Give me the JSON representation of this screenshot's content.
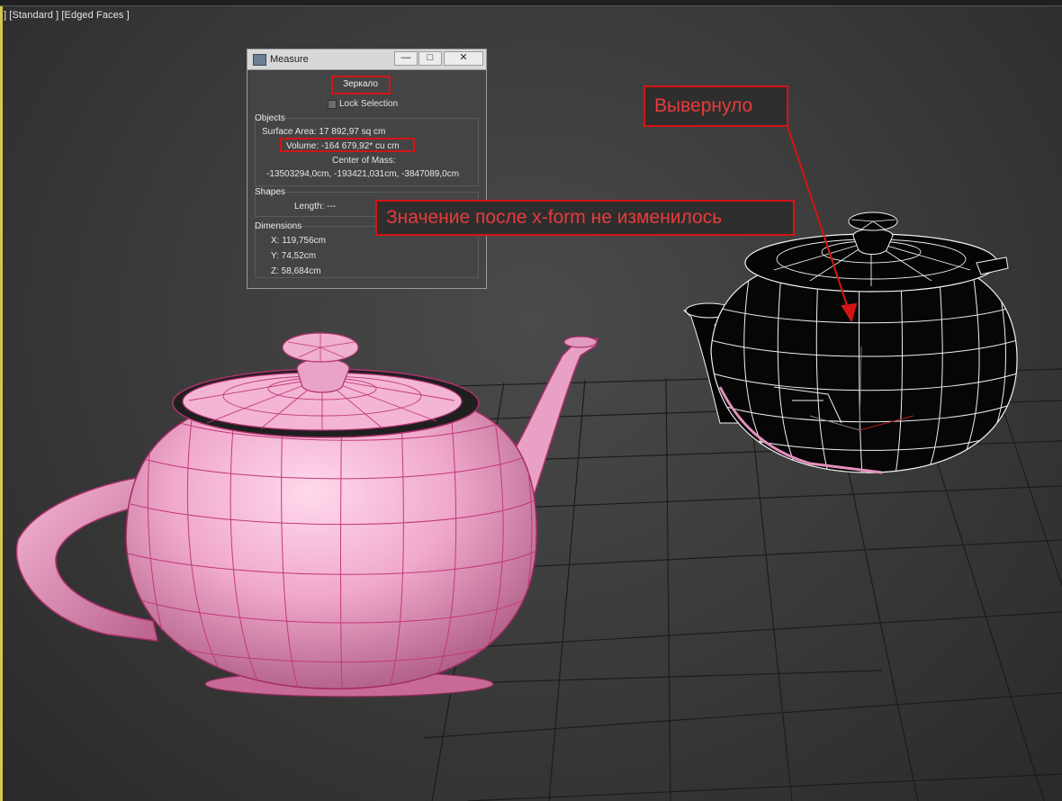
{
  "viewport": {
    "label": "] [Standard ] [Edged Faces ]"
  },
  "measure_dialog": {
    "title": "Measure",
    "controls": {
      "minimize": "—",
      "maximize": "□",
      "close": "✕"
    },
    "mirror_button": "Зеркало",
    "lock_selection": "Lock Selection",
    "objects": {
      "title": "Objects",
      "surface_area": "Surface Area:  17 892,97 sq cm",
      "volume": "Volume:  -164 679,92* cu cm",
      "center_of_mass_label": "Center of Mass:",
      "center_of_mass_value": "-13503294,0cm, -193421,031cm, -3847089,0cm"
    },
    "shapes": {
      "title": "Shapes",
      "length": "Length: ---"
    },
    "dimensions": {
      "title": "Dimensions",
      "x": "X:   119,756cm",
      "y": "Y:   74,52cm",
      "z": "Z:   58,684cm"
    }
  },
  "annotations": {
    "value_unchanged": "Значение после x-form не изменилось",
    "flipped": "Вывернуло"
  },
  "colors": {
    "annotation_red": "#d41414",
    "teapot_pink": "#e9a0c4",
    "wire_pink": "#c2397a",
    "grid_line": "#1a1a1a"
  }
}
